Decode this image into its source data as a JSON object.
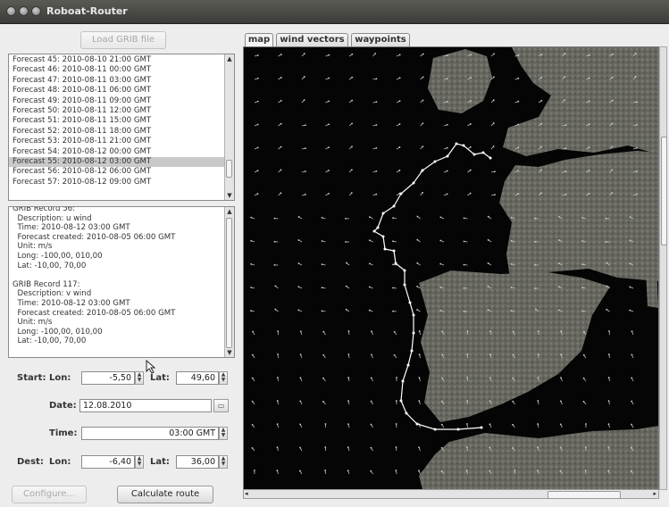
{
  "window": {
    "title": "Roboat-Router"
  },
  "buttons": {
    "load_grib": "Load GRIB file",
    "configure": "Configure...",
    "calculate": "Calculate route"
  },
  "forecasts": [
    "Forecast 45: 2010-08-10 21:00 GMT",
    "Forecast 46: 2010-08-11 00:00 GMT",
    "Forecast 47: 2010-08-11 03:00 GMT",
    "Forecast 48: 2010-08-11 06:00 GMT",
    "Forecast 49: 2010-08-11 09:00 GMT",
    "Forecast 50: 2010-08-11 12:00 GMT",
    "Forecast 51: 2010-08-11 15:00 GMT",
    "Forecast 52: 2010-08-11 18:00 GMT",
    "Forecast 53: 2010-08-11 21:00 GMT",
    "Forecast 54: 2010-08-12 00:00 GMT",
    "Forecast 55: 2010-08-12 03:00 GMT",
    "Forecast 56: 2010-08-12 06:00 GMT",
    "Forecast 57: 2010-08-12 09:00 GMT"
  ],
  "selected_forecast": 10,
  "grib_info": "GRIB Record 56:\n  Description: u wind\n  Time: 2010-08-12 03:00 GMT\n  Forecast created: 2010-08-05 06:00 GMT\n  Unit: m/s\n  Long: -100,00, 010,00\n  Lat: -10,00, 70,00\n\nGRIB Record 117:\n  Description: v wind\n  Time: 2010-08-12 03:00 GMT\n  Forecast created: 2010-08-05 06:00 GMT\n  Unit: m/s\n  Long: -100,00, 010,00\n  Lat: -10,00, 70,00",
  "form": {
    "start_label": "Start:",
    "dest_label": "Dest:",
    "lon_label": "Lon:",
    "lat_label": "Lat:",
    "date_label": "Date:",
    "time_label": "Time:",
    "start_lon": "-5,50",
    "start_lat": "49,60",
    "date": "12.08.2010",
    "time": "03:00 GMT",
    "dest_lon": "-6,40",
    "dest_lat": "36,00"
  },
  "tabs": [
    "map",
    "wind vectors",
    "waypoints"
  ],
  "active_tab": 0,
  "colors": {
    "route": "#ffffff",
    "sea": "#050505",
    "land": "#6a6a66"
  }
}
